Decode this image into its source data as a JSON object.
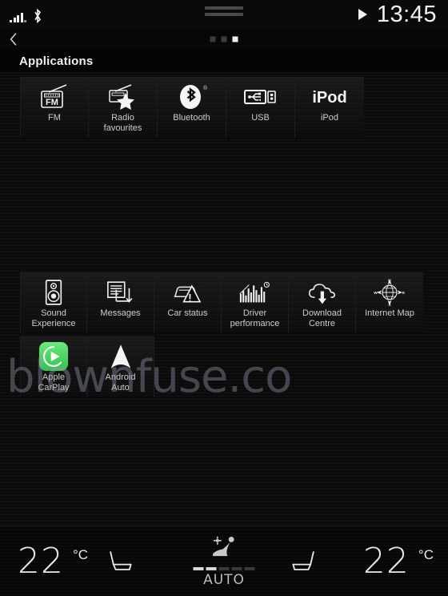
{
  "status_bar": {
    "signal_icon": "cellular-signal-icon",
    "bluetooth_icon": "bluetooth-icon",
    "handle_icon": "drag-handle-icon",
    "play_icon": "play-icon",
    "time": "13:45"
  },
  "nav": {
    "back_icon": "back-chevron-icon",
    "pages": 3,
    "active_page": 3
  },
  "page": {
    "title": "Applications"
  },
  "watermark": {
    "text": "blownfuse.co"
  },
  "apps": {
    "row1": [
      {
        "label": "FM",
        "icon": "fm-radio-icon"
      },
      {
        "label": "Radio\nfavourites",
        "icon": "radio-favourites-icon"
      },
      {
        "label": "Bluetooth",
        "icon": "bluetooth-app-icon"
      },
      {
        "label": "USB",
        "icon": "usb-icon"
      },
      {
        "label": "iPod",
        "icon": "ipod-icon"
      }
    ],
    "row2": [
      {
        "label": "Sound\nExperience",
        "icon": "speaker-icon"
      },
      {
        "label": "Messages",
        "icon": "messages-icon"
      },
      {
        "label": "Car status",
        "icon": "car-warning-icon"
      },
      {
        "label": "Driver\nperformance",
        "icon": "bar-chart-icon"
      },
      {
        "label": "Download\nCentre",
        "icon": "cloud-download-icon"
      },
      {
        "label": "Internet Map",
        "icon": "compass-globe-icon"
      }
    ],
    "row3": [
      {
        "label": "Apple\nCarPlay",
        "icon": "apple-carplay-icon"
      },
      {
        "label": "Android\nAuto",
        "icon": "android-auto-icon"
      }
    ]
  },
  "climate": {
    "left_temp": "22",
    "left_unit": "°C",
    "right_temp": "22",
    "right_unit": "°C",
    "left_seat_icon": "seat-heating-left-icon",
    "right_seat_icon": "seat-heating-right-icon",
    "auto_label": "AUTO",
    "auto_icon": "auto-climate-seat-fan-icon",
    "fan_level": 2,
    "fan_level_max": 5
  },
  "colors": {
    "background": "#050505",
    "tile": "#121212",
    "text": "#e8e8e8",
    "label": "#cdcdcd",
    "accent_active": "#f0f0f0",
    "carplay_green": "#4cd964",
    "watermark": "#969eb2"
  }
}
